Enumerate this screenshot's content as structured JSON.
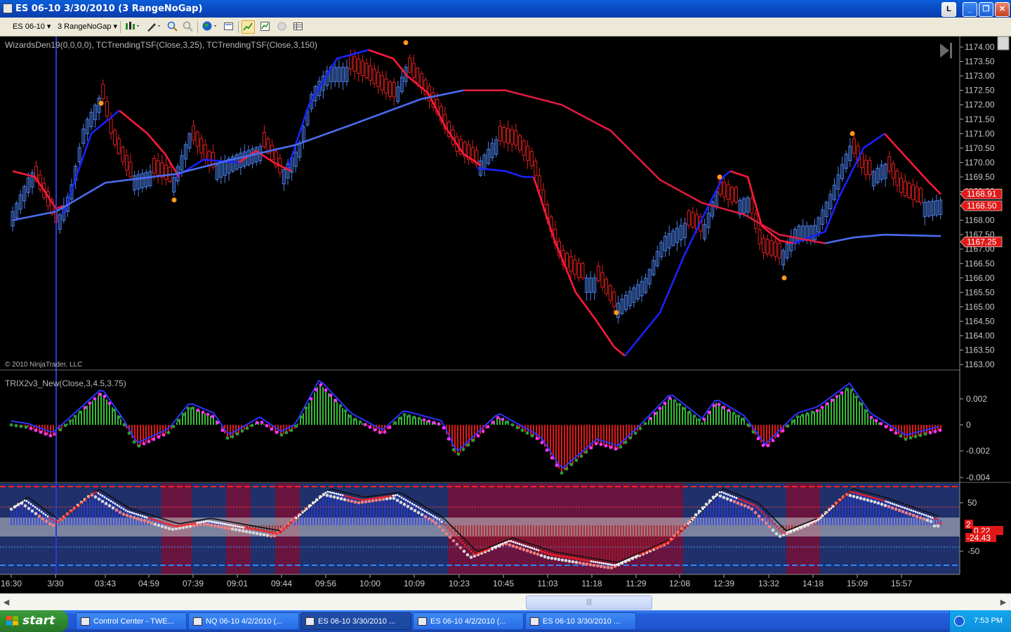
{
  "window": {
    "title": "ES 06-10  3/30/2010 (3 RangeNoGap)",
    "buttons": [
      "L",
      "_",
      "❐",
      "✕"
    ]
  },
  "toolbar": {
    "instrument": "ES 06-10",
    "period": "3 RangeNoGap"
  },
  "price_panel": {
    "indicator_label": "WizardsDen19(0,0,0,0),  TCTrendingTSF(Close,3,25),  TCTrendingTSF(Close,3,150)",
    "copyright": "© 2010 NinjaTrader, LLC",
    "price_ticks": [
      "1174.00",
      "1173.50",
      "1173.00",
      "1172.50",
      "1172.00",
      "1171.50",
      "1171.00",
      "1170.50",
      "1170.00",
      "1169.50",
      "1169.00",
      "1168.50",
      "1168.00",
      "1167.50",
      "1167.00",
      "1166.50",
      "1166.00",
      "1165.50",
      "1165.00",
      "1164.50",
      "1164.00",
      "1163.50",
      "1163.00"
    ],
    "price_badges": [
      {
        "text": "1168.91",
        "price": 1168.91
      },
      {
        "text": "1168.50",
        "price": 1168.5
      },
      {
        "text": "1167.25",
        "price": 1167.25
      }
    ]
  },
  "trix_panel": {
    "label": "TRIX2v3_New(Close,3,4.5,3.75)",
    "ticks": [
      "0.002",
      "0",
      "-0.002",
      "-0.004"
    ]
  },
  "osc_panel": {
    "ticks": [
      "50",
      "-50"
    ],
    "badges": [
      "2",
      "0.22",
      "-24.43"
    ]
  },
  "time_axis": [
    "16:30",
    "3/30",
    "03:43",
    "04:59",
    "07:39",
    "09:01",
    "09:44",
    "09:56",
    "10:00",
    "10:09",
    "10:23",
    "10:45",
    "11:03",
    "11:18",
    "11:29",
    "12:08",
    "12:39",
    "13:32",
    "14:18",
    "15:09",
    "15:57"
  ],
  "colors": {
    "up": "#4a7fe8",
    "down": "#e02020",
    "fast_up": "#1a22ff",
    "fast_down": "#ff1a3a",
    "slow": "#4a6cf0",
    "swing": "#ff9a1a"
  },
  "taskbar": {
    "start_label": "start",
    "tasks": [
      "Control Center - TWE...",
      "NQ 06-10  4/2/2010 (...",
      "ES 06-10  3/30/2010 ...",
      "ES 06-10  4/2/2010 (...",
      "ES 06-10  3/30/2010 ..."
    ],
    "clock": "7:53 PM"
  }
}
